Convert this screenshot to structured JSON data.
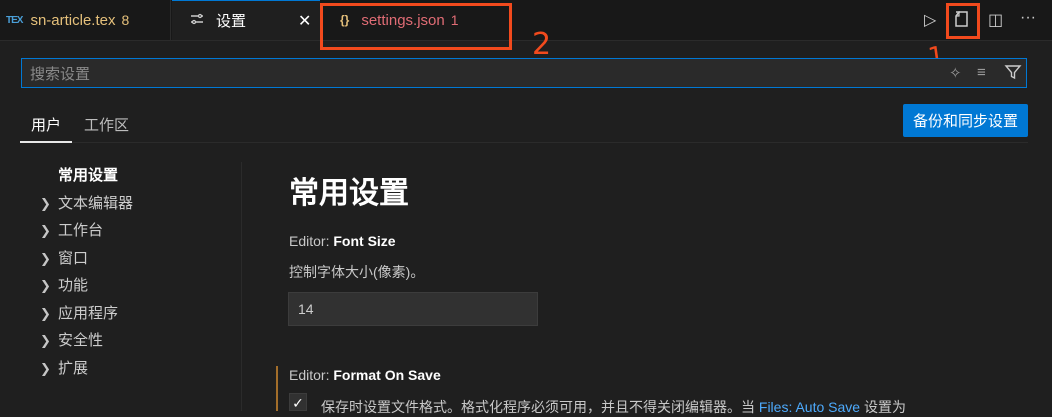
{
  "tabs": [
    {
      "icon_text": "TEX",
      "label": "sn-article.tex",
      "badge": "8"
    },
    {
      "label": "设置"
    },
    {
      "label": "settings.json",
      "badge": "1"
    }
  ],
  "annotations": {
    "one": "1",
    "two": "2"
  },
  "toolbar": {
    "run_icon": "▷",
    "open_json_icon": "open-settings-json-icon",
    "split_icon": "◫",
    "more_icon": "···"
  },
  "search": {
    "placeholder": "搜索设置",
    "value": ""
  },
  "scopes": {
    "user": "用户",
    "workspace": "工作区",
    "sync_button": "备份和同步设置"
  },
  "tree": [
    {
      "label": "常用设置",
      "active": true
    },
    {
      "label": "文本编辑器"
    },
    {
      "label": "工作台"
    },
    {
      "label": "窗口"
    },
    {
      "label": "功能"
    },
    {
      "label": "应用程序"
    },
    {
      "label": "安全性"
    },
    {
      "label": "扩展"
    }
  ],
  "main": {
    "section_title": "常用设置",
    "font_size": {
      "category": "Editor: ",
      "name": "Font Size",
      "description": "控制字体大小(像素)。",
      "value": "14"
    },
    "format_on_save": {
      "category": "Editor: ",
      "name": "Format On Save",
      "description_before": "保存时设置文件格式。格式化程序必须可用，并且不得关闭编辑器。当 ",
      "link": "Files: Auto Save",
      "description_after": " 设置为"
    }
  },
  "colors": {
    "accent": "#0078d4",
    "annotation": "#f24a1d",
    "warning": "#e5c07b",
    "error": "#e06c75"
  }
}
